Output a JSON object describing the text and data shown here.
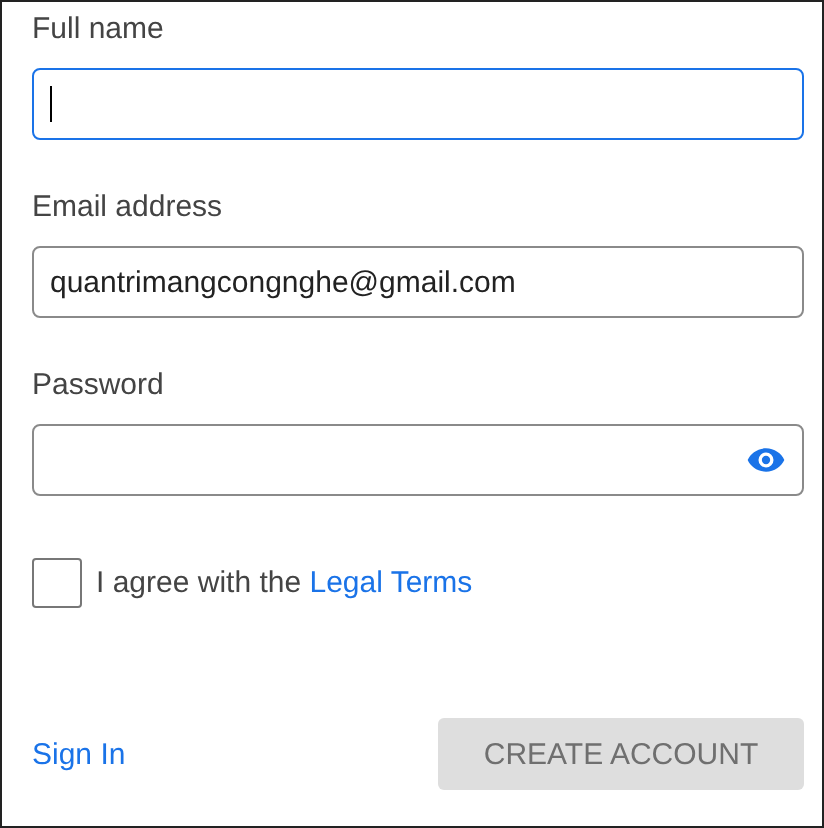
{
  "fields": [
    {
      "label": "Full name",
      "focused": true,
      "kind": "text"
    },
    {
      "label": "Email address",
      "value": "quantrimangcongnghe@gmail.com",
      "focused": false,
      "kind": "text"
    },
    {
      "label": "Password",
      "focused": false,
      "kind": "password"
    }
  ],
  "agreement": {
    "text": "I agree with the",
    "link": "Legal Terms",
    "checked": false
  },
  "sign_in": "Sign In",
  "create_button": {
    "label": "CREATE ACCOUNT",
    "disabled": true
  }
}
